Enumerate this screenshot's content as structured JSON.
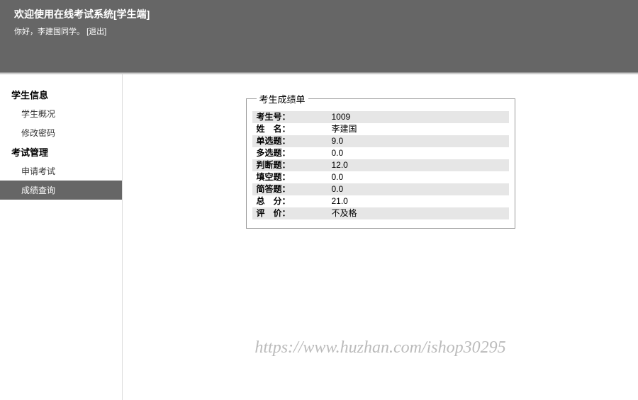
{
  "header": {
    "title": "欢迎使用在线考试系统[学生端]",
    "greeting_prefix": "你好，",
    "username": "李建国",
    "greeting_suffix": "同学。",
    "logout": "[退出]"
  },
  "sidebar": {
    "section1": {
      "title": "学生信息",
      "items": [
        {
          "label": "学生概况"
        },
        {
          "label": "修改密码"
        }
      ]
    },
    "section2": {
      "title": "考试管理",
      "items": [
        {
          "label": "申请考试"
        },
        {
          "label": "成绩查询"
        }
      ]
    }
  },
  "fieldset": {
    "legend": "考生成绩单",
    "rows": [
      {
        "label": "考生号：",
        "value": "1009"
      },
      {
        "label": "姓　名：",
        "value": "李建国"
      },
      {
        "label": "单选题：",
        "value": "9.0"
      },
      {
        "label": "多选题：",
        "value": "0.0"
      },
      {
        "label": "判断题：",
        "value": "12.0"
      },
      {
        "label": "填空题：",
        "value": "0.0"
      },
      {
        "label": "简答题：",
        "value": "0.0"
      },
      {
        "label": "总　分：",
        "value": "21.0"
      },
      {
        "label": "评　价：",
        "value": "不及格"
      }
    ]
  },
  "watermark": "https://www.huzhan.com/ishop30295"
}
